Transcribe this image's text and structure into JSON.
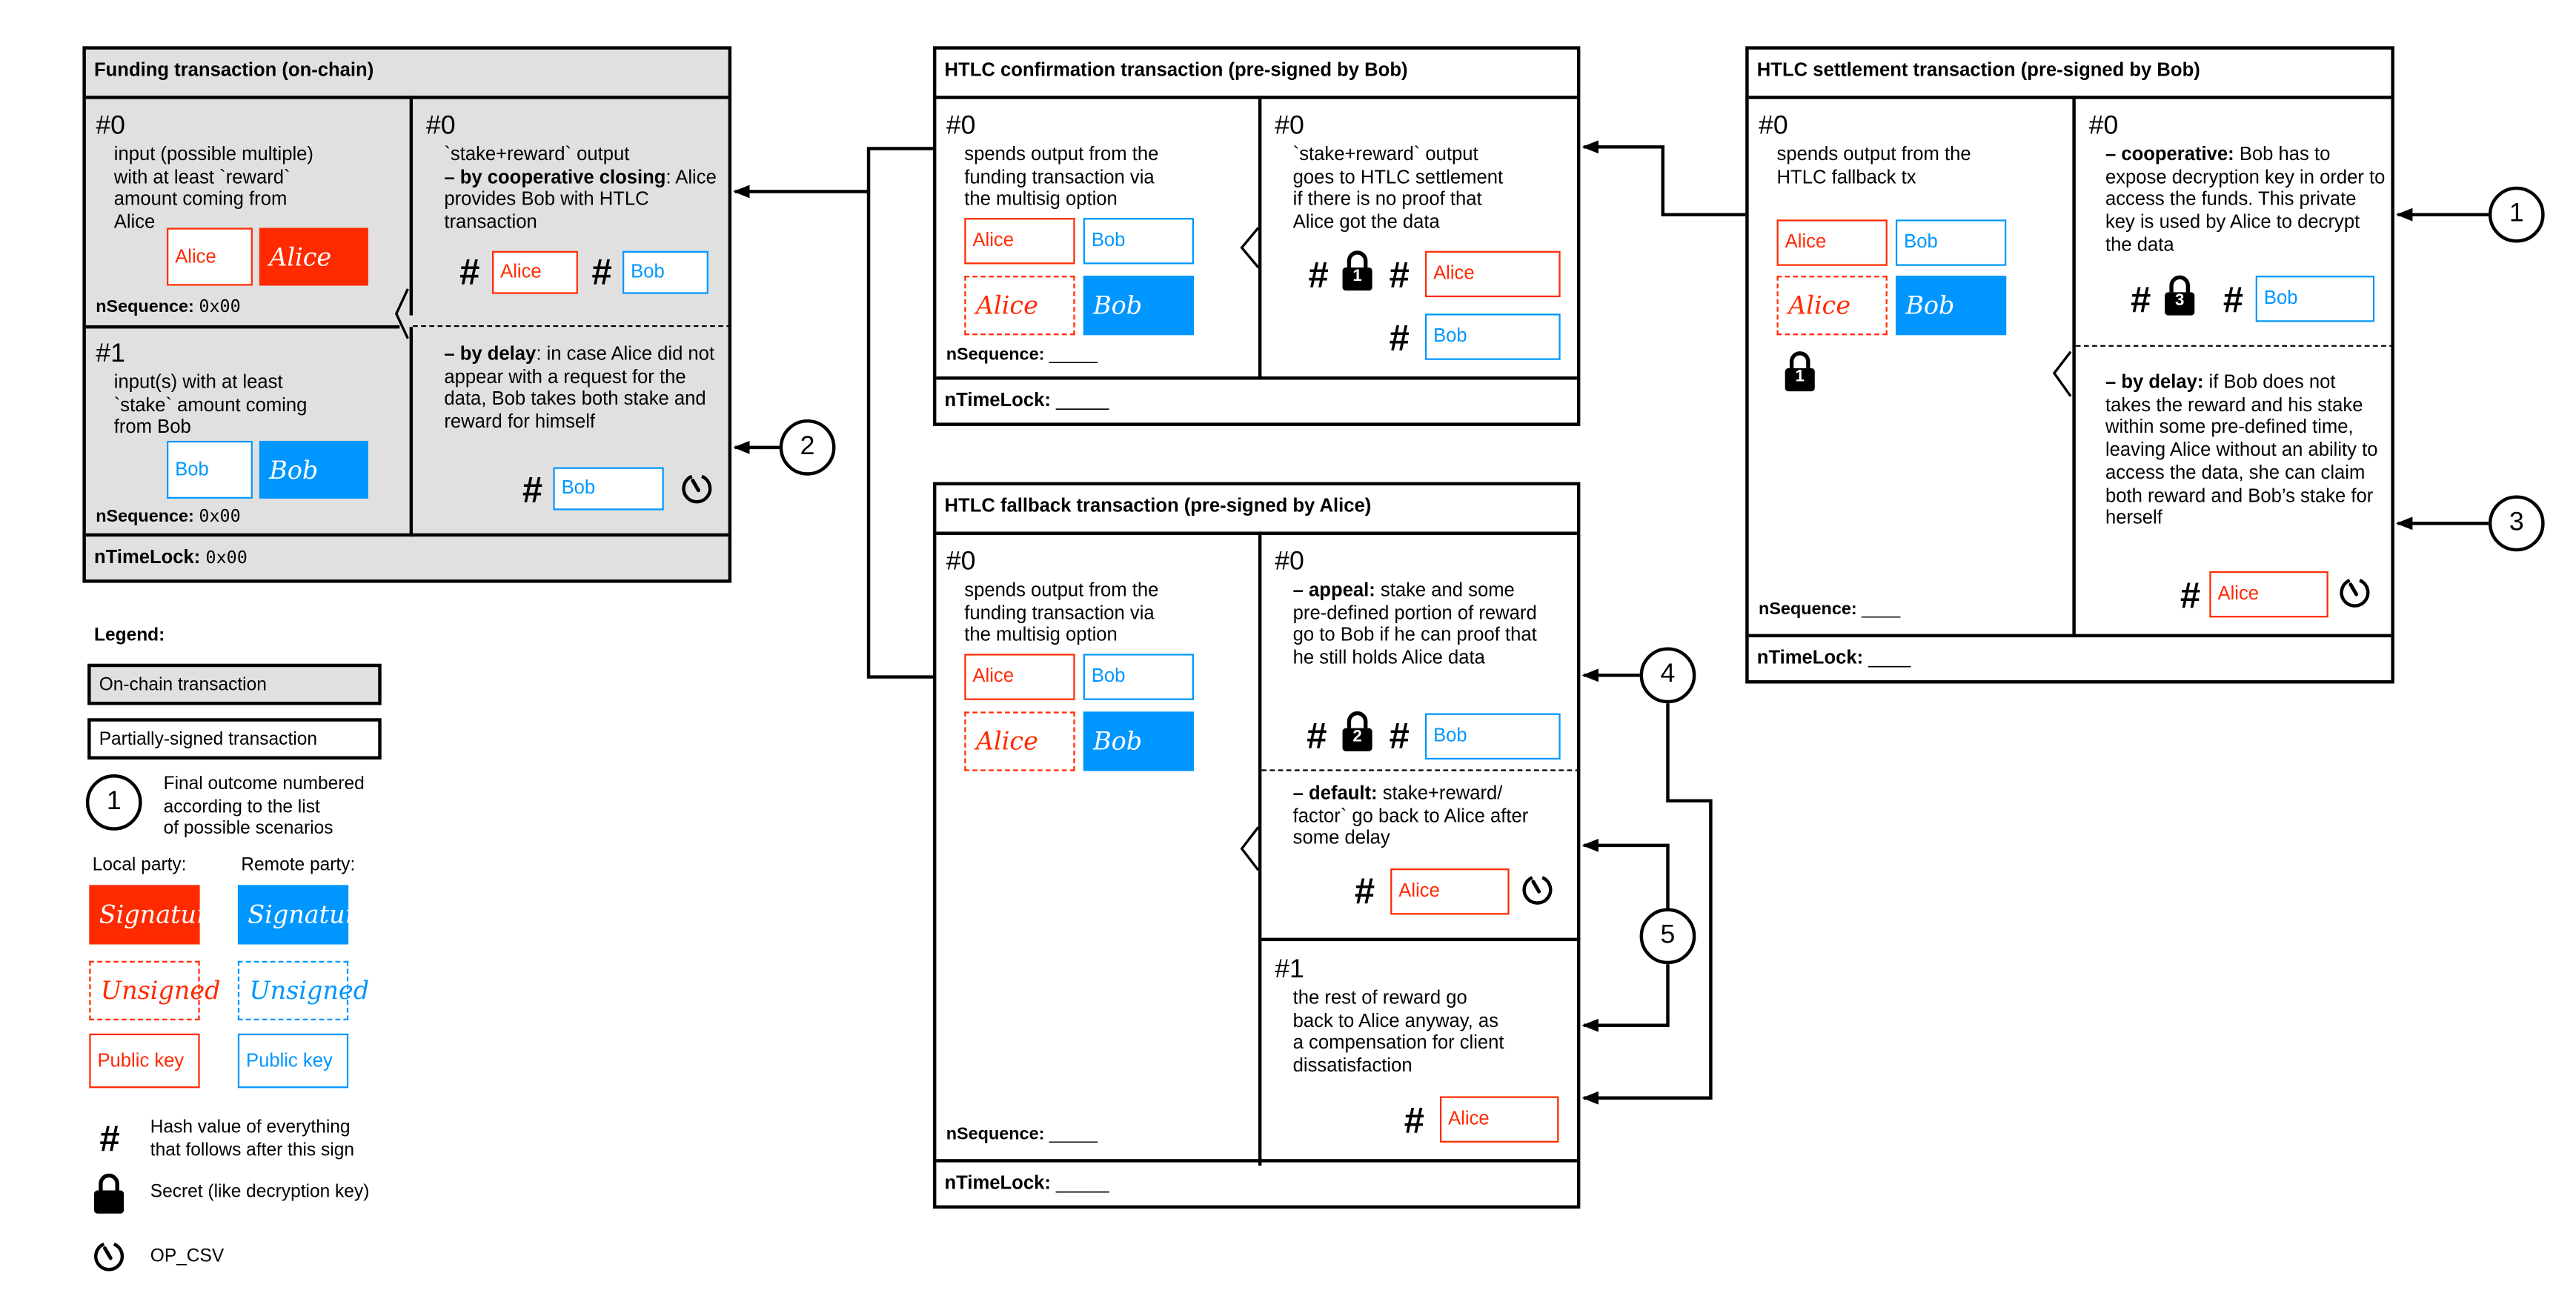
{
  "colors": {
    "local": "#ff2a00",
    "remote": "#0096ff",
    "onchain_bg": "#e0e0e0"
  },
  "funding": {
    "title": "Funding transaction (on-chain)",
    "inputs": [
      {
        "num": "#0",
        "lines": [
          "input (possible multiple)",
          "with at least `reward`",
          "amount coming from",
          "Alice"
        ],
        "pubkey": "Alice",
        "signature": "Alice",
        "nsequence_label": "nSequence:",
        "nsequence_value": "0x00"
      },
      {
        "num": "#1",
        "lines": [
          "input(s) with at least",
          "`stake` amount coming",
          "from Bob"
        ],
        "pubkey": "Bob",
        "signature": "Bob",
        "nsequence_label": "nSequence:",
        "nsequence_value": "0x00"
      }
    ],
    "output": {
      "num": "#0",
      "title": "`stake+reward` output",
      "coop_bold": "– by cooperative closing",
      "coop_text": ": Alice provides Bob with HTLC transaction",
      "coop_keys": [
        "Alice",
        "Bob"
      ],
      "delay_bold": "– by delay",
      "delay_text": ": in case Alice did not appear with a request for the data, Bob takes both stake and reward for himself",
      "delay_key": "Bob"
    },
    "ntimelock_label": "nTimeLock:",
    "ntimelock_value": "0x00"
  },
  "confirmation": {
    "title": "HTLC confirmation transaction (pre-signed by Bob)",
    "input": {
      "num": "#0",
      "lines": [
        "spends output from the",
        "funding transaction via",
        "the multisig option"
      ],
      "pubkeys": [
        "Alice",
        "Bob"
      ],
      "signatures": [
        "Alice",
        "Bob"
      ],
      "nsequence_label": "nSequence:",
      "nsequence_value": "_____"
    },
    "output": {
      "num": "#0",
      "lines": [
        "`stake+reward` output",
        "goes to HTLC settlement",
        "if there is no proof that",
        "Alice got the data"
      ],
      "lock_num": "1",
      "keys": [
        "Alice",
        "Bob"
      ]
    },
    "ntimelock_label": "nTimeLock:",
    "ntimelock_value": "_____"
  },
  "settlement": {
    "title": "HTLC settlement transaction (pre-signed by Bob)",
    "input": {
      "num": "#0",
      "lines": [
        "spends output from the",
        "HTLC fallback tx"
      ],
      "pubkeys": [
        "Alice",
        "Bob"
      ],
      "signatures": [
        "Alice",
        "Bob"
      ],
      "lock_num": "1",
      "nsequence_label": "nSequence:",
      "nsequence_value": "____"
    },
    "output": {
      "num": "#0",
      "coop_bold": "– cooperative:",
      "coop_text": " Bob has to expose decryption key in order to access the funds. This private key is used by Alice to decrypt the data",
      "lock_num": "3",
      "coop_key": "Bob",
      "delay_bold": "– by delay:",
      "delay_text": " if Bob does not takes the reward and his stake within some pre-defined time, leaving Alice without an ability to access the data, she can claim both reward and Bob’s stake for herself",
      "delay_key": "Alice"
    },
    "ntimelock_label": "nTimeLock:",
    "ntimelock_value": "____"
  },
  "fallback": {
    "title": "HTLC fallback transaction (pre-signed by Alice)",
    "input": {
      "num": "#0",
      "lines": [
        "spends output from the",
        "funding transaction via",
        "the multisig option"
      ],
      "pubkeys": [
        "Alice",
        "Bob"
      ],
      "signatures": [
        "Alice",
        "Bob"
      ],
      "nsequence_label": "nSequence:",
      "nsequence_value": "_____"
    },
    "output0": {
      "num": "#0",
      "appeal_bold": "– appeal:",
      "appeal_text": " stake and some pre-defined portion of reward go to Bob if he can proof that he still holds Alice data",
      "lock_num": "2",
      "appeal_key": "Bob",
      "default_bold": "– default:",
      "default_text": " stake+reward/ factor` go back to Alice after some delay",
      "default_key": "Alice"
    },
    "output1": {
      "num": "#1",
      "lines": [
        "the rest of reward go",
        "back to Alice anyway, as",
        "a compensation for client",
        "dissatisfaction"
      ],
      "key": "Alice"
    },
    "ntimelock_label": "nTimeLock:",
    "ntimelock_value": "_____"
  },
  "outcomes": [
    "1",
    "2",
    "3",
    "4",
    "5"
  ],
  "legend": {
    "title": "Legend:",
    "onchain": "On-chain transaction",
    "partial": "Partially-signed transaction",
    "outcome_sample": "1",
    "outcome_text": [
      "Final outcome numbered",
      "according to the list",
      "of possible scenarios"
    ],
    "local_party": "Local party:",
    "remote_party": "Remote party:",
    "signature": "Signature",
    "unsigned": "Unsigned",
    "public_key": "Public key",
    "hash_text": [
      "Hash value of everything",
      "that follows after this sign"
    ],
    "secret_text": "Secret (like decryption key)",
    "csv_text": "OP_CSV"
  }
}
